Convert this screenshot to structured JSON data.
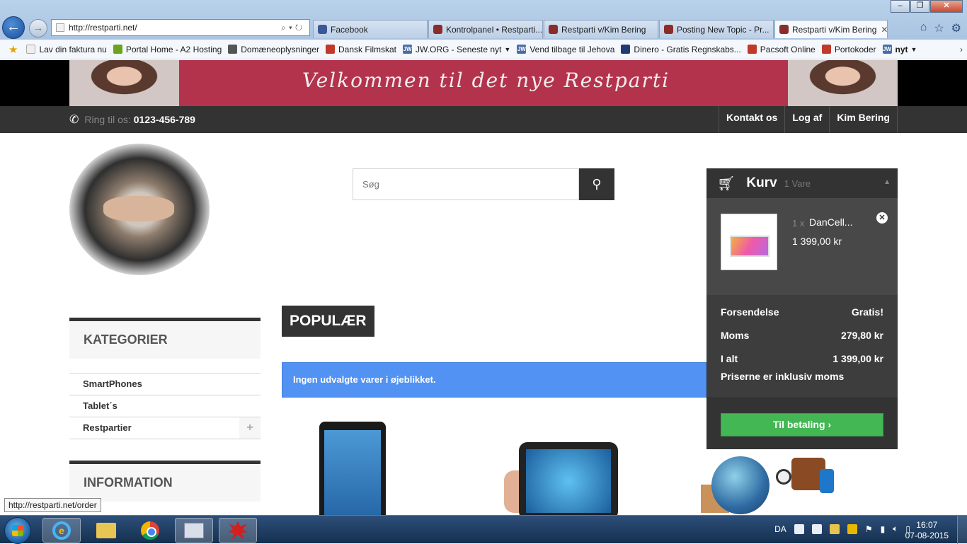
{
  "browser": {
    "url": "http://restparti.net/",
    "window_controls": [
      "–",
      "❐",
      "✕"
    ],
    "tabs": [
      {
        "label": "Facebook",
        "color": "#3b5998",
        "active": false
      },
      {
        "label": "Kontrolpanel • Restparti...",
        "color": "#8b2c2c",
        "active": false
      },
      {
        "label": "Restparti v/Kim Bering",
        "color": "#8b2c2c",
        "active": false
      },
      {
        "label": "Posting New Topic - Pr...",
        "color": "#8b2c2c",
        "active": false
      },
      {
        "label": "Restparti v/Kim Bering",
        "color": "#8b2c2c",
        "active": true
      }
    ],
    "favorites": [
      {
        "label": "Lav din faktura nu",
        "icon": "page-icon",
        "color": "#eeeeee"
      },
      {
        "label": "Portal Home - A2 Hosting",
        "icon": "a2-icon",
        "color": "#6aa321"
      },
      {
        "label": "Domæneoplysninger",
        "icon": "domain-icon",
        "color": "#555555"
      },
      {
        "label": "Dansk Filmskat",
        "icon": "film-icon",
        "color": "#c0392b"
      },
      {
        "label": "JW.ORG - Seneste nyt",
        "icon": "jw-icon",
        "color": "#4a6da7",
        "dropdown": true
      },
      {
        "label": "Vend tilbage til Jehova",
        "icon": "jw-icon",
        "color": "#4a6da7"
      },
      {
        "label": "Dinero - Gratis Regnskabs...",
        "icon": "dinero-icon",
        "color": "#1f3b73"
      },
      {
        "label": "Pacsoft Online",
        "icon": "pacsoft-icon",
        "color": "#c0392b"
      },
      {
        "label": "Portokoder",
        "icon": "post-icon",
        "color": "#c0392b"
      },
      {
        "label": "nyt",
        "icon": "jw-icon",
        "color": "#4a6da7",
        "dropdown": true
      }
    ]
  },
  "site": {
    "banner_text": "Velkommen til det nye Restparti",
    "phone_label": "Ring til os:",
    "phone_number": "0123-456-789",
    "top_links": [
      "Kontakt os",
      "Log af",
      "Kim Bering"
    ],
    "search": {
      "placeholder": "Søg"
    },
    "cart": {
      "title": "Kurv",
      "count": "1 Vare",
      "item": {
        "qty": "1 x",
        "name": "DanCell...",
        "price": "1 399,00 kr"
      },
      "rows": [
        {
          "label": "Forsendelse",
          "value": "Gratis!"
        },
        {
          "label": "Moms",
          "value": "279,80 kr"
        },
        {
          "label": "I alt",
          "value": "1 399,00 kr"
        }
      ],
      "note": "Priserne er inklusiv moms",
      "checkout": "Til betaling"
    },
    "categories": {
      "title": "KATEGORIER",
      "items": [
        "SmartPhones",
        "Tablet´s",
        "Restpartier"
      ]
    },
    "information_title": "INFORMATION",
    "popular_tab": "POPULÆR",
    "alert": "Ingen udvalgte varer i øjeblikket."
  },
  "status_url": "http://restparti.net/order",
  "taskbar": {
    "language": "DA",
    "time": "16:07",
    "date": "07-08-2015"
  }
}
